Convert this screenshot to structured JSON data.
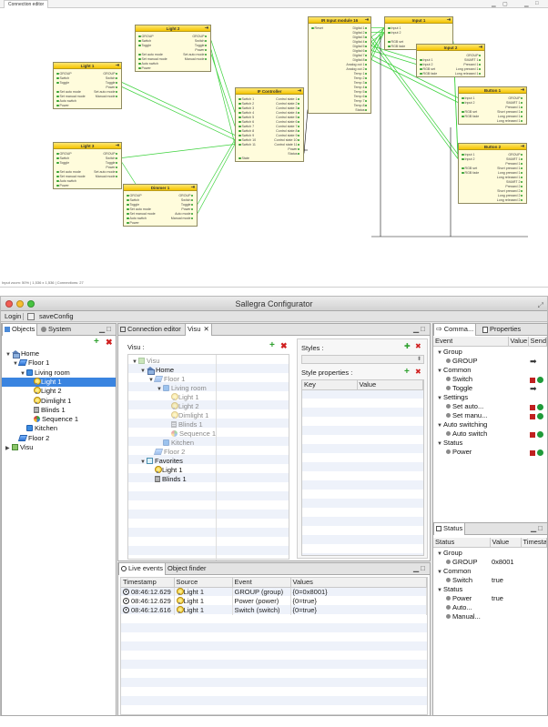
{
  "diagram": {
    "tab_label": "Connection editor",
    "status": "Input zoom: 50% | 1,536 x 1,536 | Connections: 27",
    "nodes": {
      "n1": {
        "title": "Light 1",
        "rows": [
          [
            "GROUP",
            "GROUP"
          ],
          [
            "Switch",
            "Switch"
          ],
          [
            "Toggle",
            "Toggle"
          ],
          [
            "",
            "Power"
          ],
          [
            "Set auto mode",
            "Set auto mode"
          ],
          [
            "Set manual mode",
            "Manual mode"
          ],
          [
            "Auto switch",
            ""
          ],
          [
            "Power",
            ""
          ]
        ]
      },
      "n2": {
        "title": "Light 2",
        "rows": [
          [
            "GROUP",
            "GROUP"
          ],
          [
            "Switch",
            "Switch"
          ],
          [
            "Toggle",
            "Toggle"
          ],
          [
            "",
            "Power"
          ],
          [
            "Set auto mode",
            "Set auto mode"
          ],
          [
            "Set manual mode",
            "Manual mode"
          ],
          [
            "Auto switch",
            ""
          ],
          [
            "Power",
            ""
          ]
        ]
      },
      "n3": {
        "title": "Light 3",
        "rows": [
          [
            "GROUP",
            "GROUP"
          ],
          [
            "Switch",
            "Switch"
          ],
          [
            "Toggle",
            "Toggle"
          ],
          [
            "",
            "Power"
          ],
          [
            "Set auto mode",
            "Set auto mode"
          ],
          [
            "Set manual mode",
            "Manual mode"
          ],
          [
            "Auto switch",
            ""
          ],
          [
            "Power",
            ""
          ]
        ]
      },
      "n4": {
        "title": "Dimmer 1",
        "rows": [
          [
            "GROUP",
            "GROUP"
          ],
          [
            "Switch",
            "Switch"
          ],
          [
            "Toggle",
            "Toggle"
          ],
          [
            "Set auto mode",
            "Power"
          ],
          [
            "Set manual mode",
            "Auto mode"
          ],
          [
            "Auto switch",
            "Manual mode"
          ],
          [
            "Power",
            ""
          ]
        ]
      },
      "n5": {
        "title": "IF Controller",
        "rows": [
          [
            "Switch 1",
            "Control state 1"
          ],
          [
            "Switch 2",
            "Control state 2"
          ],
          [
            "Switch 3",
            "Control state 3"
          ],
          [
            "Switch 4",
            "Control state 4"
          ],
          [
            "Switch 5",
            "Control state 5"
          ],
          [
            "Switch 6",
            "Control state 6"
          ],
          [
            "Switch 7",
            "Control state 7"
          ],
          [
            "Switch 8",
            "Control state 8"
          ],
          [
            "Switch 9",
            "Control state 9"
          ],
          [
            "Switch 10",
            "Control state 10"
          ],
          [
            "Switch 11",
            "Control state 11"
          ],
          [
            "",
            "Power"
          ],
          [
            "",
            "Status"
          ],
          [
            "State",
            ""
          ]
        ]
      },
      "n6": {
        "title": "IR Input module 16",
        "rows": [
          [
            "Reset",
            "Digital 1"
          ],
          [
            "",
            "Digital 2"
          ],
          [
            "",
            "Digital 3"
          ],
          [
            "",
            "Digital 4"
          ],
          [
            "",
            "Digital 5"
          ],
          [
            "",
            "Digital 6"
          ],
          [
            "",
            "Digital 7"
          ],
          [
            "",
            "Digital 8"
          ],
          [
            "",
            "Analog out 1"
          ],
          [
            "",
            "Analog out 2"
          ],
          [
            "",
            "Temp 1"
          ],
          [
            "",
            "Temp 2"
          ],
          [
            "",
            "Temp 3"
          ],
          [
            "",
            "Temp 4"
          ],
          [
            "",
            "Temp 5"
          ],
          [
            "",
            "Temp 6"
          ],
          [
            "",
            "Temp 7"
          ],
          [
            "",
            "Temp 8"
          ],
          [
            "",
            "Status"
          ]
        ]
      },
      "n7": {
        "title": "Input 1",
        "rows": [
          [
            "Input 1",
            ""
          ],
          [
            "Input 2",
            ""
          ],
          [
            "",
            ""
          ],
          [
            "RGB set",
            ""
          ],
          [
            "RGB fade",
            ""
          ]
        ]
      },
      "n8": {
        "title": "Input 2",
        "rows": [
          [
            "",
            "GROUP"
          ],
          [
            "Input 1",
            "SMART 1"
          ],
          [
            "Input 2",
            "Pressed 1"
          ],
          [
            "RGB set",
            "Long pressed 1"
          ],
          [
            "RGB fade",
            "Long released 1"
          ]
        ]
      },
      "n9": {
        "title": "Button 1",
        "rows": [
          [
            "Input 1",
            "GROUP"
          ],
          [
            "Input 2",
            "SMART 1"
          ],
          [
            "",
            "Pressed 1"
          ],
          [
            "RGB set",
            "Short pressed 1"
          ],
          [
            "RGB fade",
            "Long pressed 1"
          ],
          [
            "",
            "Long released 1"
          ]
        ]
      },
      "n10": {
        "title": "Button 2",
        "rows": [
          [
            "Input 1",
            "GROUP"
          ],
          [
            "Input 2",
            "SMART 1"
          ],
          [
            "",
            "Pressed 1"
          ],
          [
            "RGB set",
            "Short pressed 1"
          ],
          [
            "RGB fade",
            "Long pressed 1"
          ],
          [
            "",
            "Long released 1"
          ],
          [
            "",
            "SMART 2"
          ],
          [
            "",
            "Pressed 2"
          ],
          [
            "",
            "Short pressed 2"
          ],
          [
            "",
            "Long pressed 2"
          ],
          [
            "",
            "Long released 2"
          ]
        ]
      }
    }
  },
  "window": {
    "title": "Sallegra Configurator"
  },
  "toolbar": {
    "login": "Login",
    "save_config": "saveConfig"
  },
  "left_panel": {
    "tabs": [
      "Objects",
      "System"
    ],
    "tree": [
      {
        "label": "Home",
        "icon": "house-icon",
        "depth": 0,
        "arrow": "▼"
      },
      {
        "label": "Floor 1",
        "icon": "floor-icon",
        "depth": 1,
        "arrow": "▼"
      },
      {
        "label": "Living room",
        "icon": "room-icon",
        "depth": 2,
        "arrow": "▼"
      },
      {
        "label": "Light 1",
        "icon": "bulb-icon",
        "depth": 3,
        "arrow": "",
        "selected": true
      },
      {
        "label": "Light 2",
        "icon": "bulb-icon",
        "depth": 3,
        "arrow": ""
      },
      {
        "label": "Dimlight 1",
        "icon": "bulb-icon",
        "depth": 3,
        "arrow": ""
      },
      {
        "label": "Blinds 1",
        "icon": "blinds-icon",
        "depth": 3,
        "arrow": ""
      },
      {
        "label": "Sequence 1",
        "icon": "sequence-icon",
        "depth": 3,
        "arrow": ""
      },
      {
        "label": "Kitchen",
        "icon": "room-icon",
        "depth": 2,
        "arrow": ""
      },
      {
        "label": "Floor 2",
        "icon": "floor-icon",
        "depth": 1,
        "arrow": ""
      },
      {
        "label": "Visu",
        "icon": "visu-icon",
        "depth": 0,
        "arrow": "▶"
      }
    ]
  },
  "center_panel": {
    "tabs": [
      "Connection editor",
      "Visu"
    ],
    "visu_label": "Visu :",
    "styles_label": "Styles :",
    "style_props_label": "Style properties :",
    "style_props_cols": [
      "Key",
      "Value"
    ],
    "visu_tree": [
      {
        "label": "Visu",
        "icon": "visu-icon",
        "depth": 0,
        "arrow": "▼",
        "muted": true
      },
      {
        "label": "Home",
        "icon": "house-icon",
        "depth": 1,
        "arrow": "▼"
      },
      {
        "label": "Floor 1",
        "icon": "floor-icon",
        "depth": 2,
        "arrow": "▼",
        "muted": true
      },
      {
        "label": "Living room",
        "icon": "room-icon",
        "depth": 3,
        "arrow": "▼",
        "muted": true
      },
      {
        "label": "Light 1",
        "icon": "bulb-icon",
        "depth": 4,
        "arrow": "",
        "muted": true
      },
      {
        "label": "Light 2",
        "icon": "bulb-icon",
        "depth": 4,
        "arrow": "",
        "muted": true
      },
      {
        "label": "Dimlight 1",
        "icon": "bulb-icon",
        "depth": 4,
        "arrow": "",
        "muted": true
      },
      {
        "label": "Blinds 1",
        "icon": "blinds-icon",
        "depth": 4,
        "arrow": "",
        "muted": true
      },
      {
        "label": "Sequence 1",
        "icon": "sequence-icon",
        "depth": 4,
        "arrow": "",
        "muted": true
      },
      {
        "label": "Kitchen",
        "icon": "room-icon",
        "depth": 3,
        "arrow": "",
        "muted": true
      },
      {
        "label": "Floor 2",
        "icon": "floor-icon",
        "depth": 2,
        "arrow": "",
        "muted": true
      },
      {
        "label": "Favorites",
        "icon": "favorites-icon",
        "depth": 1,
        "arrow": "▼"
      },
      {
        "label": "Light 1",
        "icon": "bulb-icon",
        "depth": 2,
        "arrow": ""
      },
      {
        "label": "Blinds 1",
        "icon": "blinds-icon",
        "depth": 2,
        "arrow": ""
      }
    ]
  },
  "bottom_panel": {
    "tabs": [
      "Live events",
      "Object finder"
    ],
    "columns": [
      "Timestamp",
      "Source",
      "Event",
      "Values"
    ],
    "rows": [
      {
        "timestamp": "08:46:12.629",
        "source": "Light 1",
        "event": "GROUP (group)",
        "values": "{0=0x8001}"
      },
      {
        "timestamp": "08:46:12.629",
        "source": "Light 1",
        "event": "Power (power)",
        "values": "{0=true}"
      },
      {
        "timestamp": "08:46:12.616",
        "source": "Light 1",
        "event": "Switch (switch)",
        "values": "{0=true}"
      }
    ]
  },
  "right_top_panel": {
    "tabs": [
      "Comma...",
      "Properties"
    ],
    "columns": [
      "Event",
      "Value",
      "Send"
    ],
    "rows": [
      {
        "label": "Group",
        "depth": 0,
        "group": true
      },
      {
        "label": "GROUP",
        "depth": 1,
        "control": "arrow"
      },
      {
        "label": "Common",
        "depth": 0,
        "group": true
      },
      {
        "label": "Switch",
        "depth": 1,
        "control": "square-dot"
      },
      {
        "label": "Toggle",
        "depth": 1,
        "control": "arrow"
      },
      {
        "label": "Settings",
        "depth": 0,
        "group": true
      },
      {
        "label": "Set auto...",
        "depth": 1,
        "control": "square-dot"
      },
      {
        "label": "Set manu...",
        "depth": 1,
        "control": "square-dot"
      },
      {
        "label": "Auto switching",
        "depth": 0,
        "group": true
      },
      {
        "label": "Auto switch",
        "depth": 1,
        "control": "square-dot"
      },
      {
        "label": "Status",
        "depth": 0,
        "group": true
      },
      {
        "label": "Power",
        "depth": 1,
        "control": "square-dot"
      }
    ]
  },
  "right_bottom_panel": {
    "tabs": [
      "Status"
    ],
    "columns": [
      "Status",
      "Value",
      "Timesta"
    ],
    "rows": [
      {
        "label": "Group",
        "depth": 0,
        "value": "",
        "group": true
      },
      {
        "label": "GROUP",
        "depth": 1,
        "value": "0x8001"
      },
      {
        "label": "Common",
        "depth": 0,
        "value": "",
        "group": true
      },
      {
        "label": "Switch",
        "depth": 1,
        "value": "true"
      },
      {
        "label": "Status",
        "depth": 0,
        "value": "",
        "group": true
      },
      {
        "label": "Power",
        "depth": 1,
        "value": "true"
      },
      {
        "label": "Auto...",
        "depth": 1,
        "value": ""
      },
      {
        "label": "Manual...",
        "depth": 1,
        "value": ""
      }
    ]
  },
  "colors": {
    "accent": "#3a84e0",
    "node_header": "#f4c400",
    "wire": "#3cd23c",
    "ok": "#1f9a3a",
    "stop": "#c02020"
  }
}
